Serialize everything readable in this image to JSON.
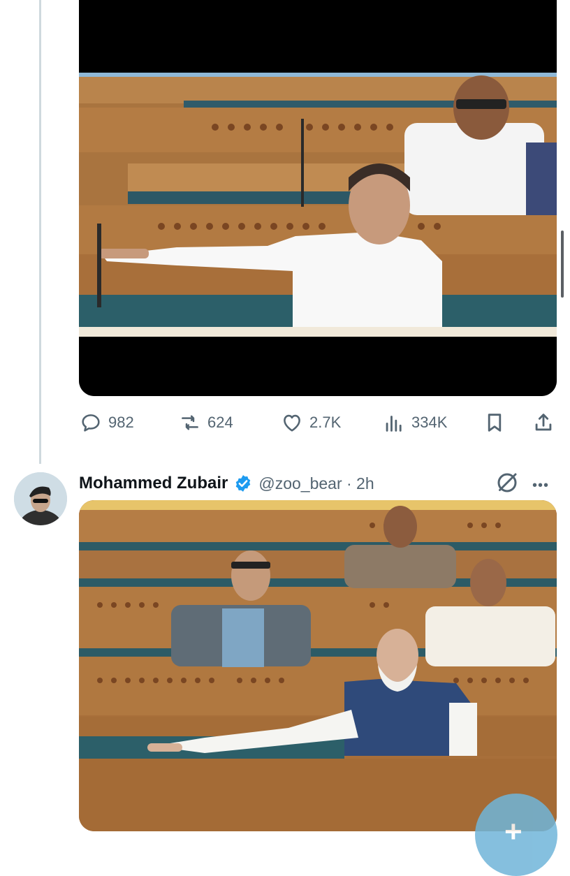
{
  "tweet1": {
    "stats": {
      "replies": "982",
      "reposts": "624",
      "likes": "2.7K",
      "views": "334K"
    }
  },
  "tweet2": {
    "author_name": "Mohammed Zubair",
    "handle_time": "@zoo_bear · 2h",
    "more_icon": "•••"
  },
  "colors": {
    "accent": "#1d9bf0",
    "muted": "#536471",
    "thread_line": "#cfd9de"
  },
  "icons": [
    "reply-icon",
    "repost-icon",
    "like-icon",
    "views-icon",
    "bookmark-icon",
    "share-icon",
    "verified-badge-icon",
    "grok-icon",
    "more-icon",
    "compose-plus-icon"
  ]
}
